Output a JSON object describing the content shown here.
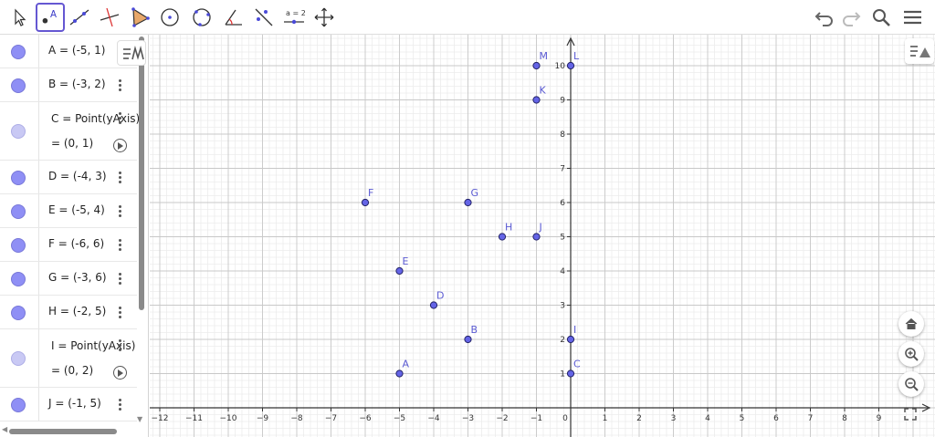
{
  "toolbar": {
    "tools": [
      {
        "name": "move-tool-icon",
        "active": false
      },
      {
        "name": "point-tool-icon",
        "active": true
      },
      {
        "name": "line-tool-icon",
        "active": false
      },
      {
        "name": "perpendicular-line-tool-icon",
        "active": false
      },
      {
        "name": "polygon-tool-icon",
        "active": false
      },
      {
        "name": "circle-center-point-tool-icon",
        "active": false
      },
      {
        "name": "circle-three-points-tool-icon",
        "active": false
      },
      {
        "name": "angle-tool-icon",
        "active": false
      },
      {
        "name": "reflect-tool-icon",
        "active": false
      },
      {
        "name": "slider-tool-icon",
        "active": false
      },
      {
        "name": "move-graphics-view-tool-icon",
        "active": false
      }
    ],
    "slider_label": "a = 2",
    "right_icons": [
      "undo-icon",
      "redo-icon",
      "search-icon",
      "menu-icon"
    ]
  },
  "algebra": {
    "items": [
      {
        "line1": "A = (-5, 1)",
        "light": false
      },
      {
        "line1": "B = (-3, 2)",
        "light": false
      },
      {
        "line1": "C = Point(yAxis)",
        "line2": "= (0, 1)",
        "light": true
      },
      {
        "line1": "D = (-4, 3)",
        "light": false
      },
      {
        "line1": "E = (-5, 4)",
        "light": false
      },
      {
        "line1": "F = (-6, 6)",
        "light": false
      },
      {
        "line1": "G = (-3, 6)",
        "light": false
      },
      {
        "line1": "H = (-2, 5)",
        "light": false
      },
      {
        "line1": "I = Point(yAxis)",
        "line2": "= (0, 2)",
        "light": true
      },
      {
        "line1": "J = (-1, 5)",
        "light": false
      }
    ]
  },
  "graphics": {
    "x_ticks": [
      "−12",
      "−11",
      "−10",
      "−9",
      "−8",
      "−7",
      "−6",
      "−5",
      "−4",
      "−3",
      "−2",
      "−1",
      "0",
      "1",
      "2",
      "3",
      "4",
      "5",
      "6",
      "7",
      "8",
      "9"
    ],
    "y_ticks": [
      "1",
      "2",
      "3",
      "4",
      "5",
      "6",
      "7",
      "8",
      "9",
      "10"
    ],
    "points": [
      {
        "label": "A",
        "x": -5,
        "y": 1
      },
      {
        "label": "B",
        "x": -3,
        "y": 2
      },
      {
        "label": "C",
        "x": 0,
        "y": 1
      },
      {
        "label": "D",
        "x": -4,
        "y": 3
      },
      {
        "label": "E",
        "x": -5,
        "y": 4
      },
      {
        "label": "F",
        "x": -6,
        "y": 6
      },
      {
        "label": "G",
        "x": -3,
        "y": 6
      },
      {
        "label": "H",
        "x": -2,
        "y": 5
      },
      {
        "label": "I",
        "x": 0,
        "y": 2
      },
      {
        "label": "J",
        "x": -1,
        "y": 5
      },
      {
        "label": "K",
        "x": -1,
        "y": 9
      },
      {
        "label": "L",
        "x": 0,
        "y": 10
      },
      {
        "label": "M",
        "x": -1,
        "y": 10
      }
    ],
    "colors": {
      "point_fill": "#6464e6",
      "point_stroke": "#222266",
      "label": "#5a5ad2",
      "grid_major": "#c8c8c8",
      "grid_minor": "#ececec"
    },
    "view_buttons": [
      "home-icon",
      "zoom-in-icon",
      "zoom-out-icon"
    ]
  }
}
